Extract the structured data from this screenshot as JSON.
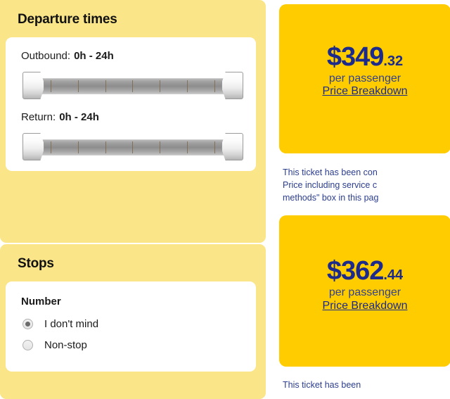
{
  "filters": {
    "departure": {
      "heading": "Departure times",
      "sliders": [
        {
          "name": "outbound",
          "label": "Outbound:",
          "value": "0h - 24h",
          "min_handle": "left-handle",
          "max_handle": "right-handle",
          "ticks": 7
        },
        {
          "name": "return",
          "label": "Return:",
          "value": "0h - 24h",
          "min_handle": "left-handle",
          "max_handle": "right-handle",
          "ticks": 7
        }
      ]
    },
    "stops": {
      "heading": "Stops",
      "sub_heading": "Number",
      "options": [
        {
          "label": "I don't mind",
          "selected": true
        },
        {
          "label": "Non-stop",
          "selected": false
        }
      ]
    }
  },
  "results": [
    {
      "price_dollars": "$349",
      "price_cents": ".32",
      "per": "per passenger",
      "link": "Price Breakdown",
      "note_lines": [
        "This ticket has been con",
        "Price including service c",
        "methods\" box in this pag"
      ]
    },
    {
      "price_dollars": "$362",
      "price_cents": ".44",
      "per": "per passenger",
      "link": "Price Breakdown",
      "note_lines": [
        "This ticket has been"
      ]
    }
  ],
  "colors": {
    "panel_yellow": "#fae588",
    "box_gold": "#ffcc00",
    "price_blue": "#1b2a8b",
    "note_blue": "#2b3d8e",
    "card_white": "#ffffff"
  }
}
